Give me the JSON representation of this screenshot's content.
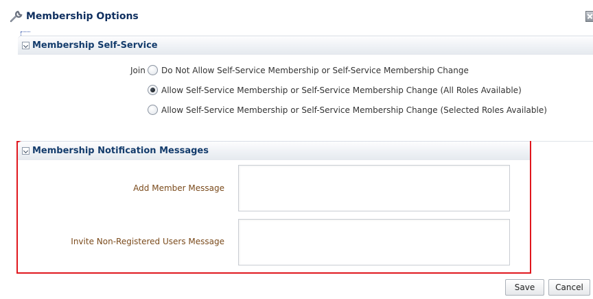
{
  "dialog": {
    "title": "Membership Options",
    "title_icon": "wrench-icon",
    "close_icon": "close-icon"
  },
  "self_service": {
    "header": "Membership Self-Service",
    "join_label": "Join",
    "options": [
      {
        "label": "Do Not Allow Self-Service Membership or Self-Service Membership Change",
        "selected": false
      },
      {
        "label": "Allow Self-Service Membership or Self-Service Membership Change (All Roles Available)",
        "selected": true
      },
      {
        "label": "Allow Self-Service Membership or Self-Service Membership Change (Selected Roles Available)",
        "selected": false
      }
    ]
  },
  "notifications": {
    "header": "Membership Notification Messages",
    "add_member_label": "Add Member Message",
    "add_member_value": "",
    "invite_label": "Invite Non-Registered Users Message",
    "invite_value": ""
  },
  "actions": {
    "save_label": "Save",
    "cancel_label": "Cancel"
  },
  "colors": {
    "highlight_border": "#e0161d",
    "header_text": "#143c6c",
    "field_label": "#7a4a1b"
  }
}
